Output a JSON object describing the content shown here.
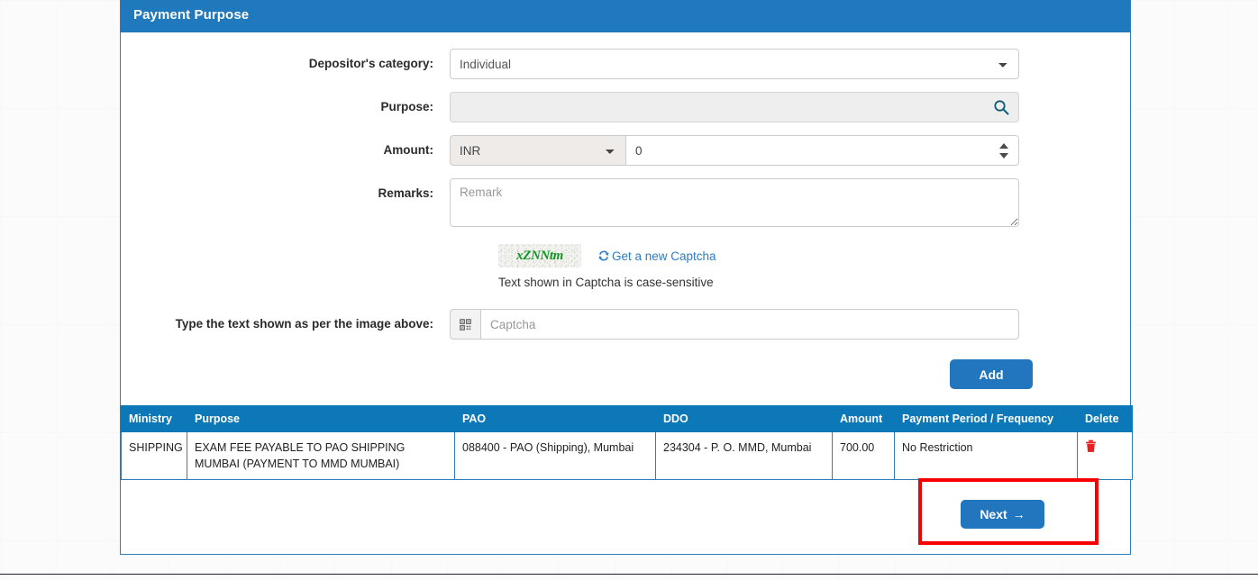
{
  "panel": {
    "title": "Payment Purpose"
  },
  "form": {
    "depositor_category": {
      "label": "Depositor's category:",
      "value": "Individual",
      "options": [
        "Individual"
      ]
    },
    "purpose": {
      "label": "Purpose:",
      "value": "",
      "placeholder": "",
      "icon": "search-icon"
    },
    "amount": {
      "label": "Amount:",
      "currency": "INR",
      "currency_options": [
        "INR"
      ],
      "value": "0"
    },
    "remarks": {
      "label": "Remarks:",
      "value": "",
      "placeholder": "Remark"
    }
  },
  "captcha": {
    "image_text": "xZNNtm",
    "refresh_label": "Get a new Captcha",
    "refresh_icon": "refresh-icon",
    "note": "Text shown in Captcha is case-sensitive",
    "input_label": "Type the text shown as per the image above:",
    "input_value": "",
    "input_placeholder": "Captcha",
    "input_icon": "qr-code-icon"
  },
  "buttons": {
    "add": "Add",
    "next": "Next",
    "next_arrow": "→"
  },
  "table": {
    "columns": [
      "Ministry",
      "Purpose",
      "PAO",
      "DDO",
      "Amount",
      "Payment Period / Frequency",
      "Delete"
    ],
    "rows": [
      {
        "ministry": "SHIPPING",
        "purpose": "EXAM FEE PAYABLE TO PAO SHIPPING MUMBAI (PAYMENT TO MMD MUMBAI)",
        "pao": "088400 - PAO (Shipping), Mumbai",
        "ddo": "234304 - P. O. MMD, Mumbai",
        "amount": "700.00",
        "period": "No Restriction",
        "delete_icon": "trash-icon"
      }
    ]
  },
  "colors": {
    "panel_header_blue": "#2079bd",
    "table_header_blue": "#0c78b8",
    "button_blue": "#2176bd",
    "link_blue": "#2e7cc4",
    "captcha_green": "#109820",
    "delete_red": "#e8201f",
    "highlight_red": "#f60000"
  }
}
